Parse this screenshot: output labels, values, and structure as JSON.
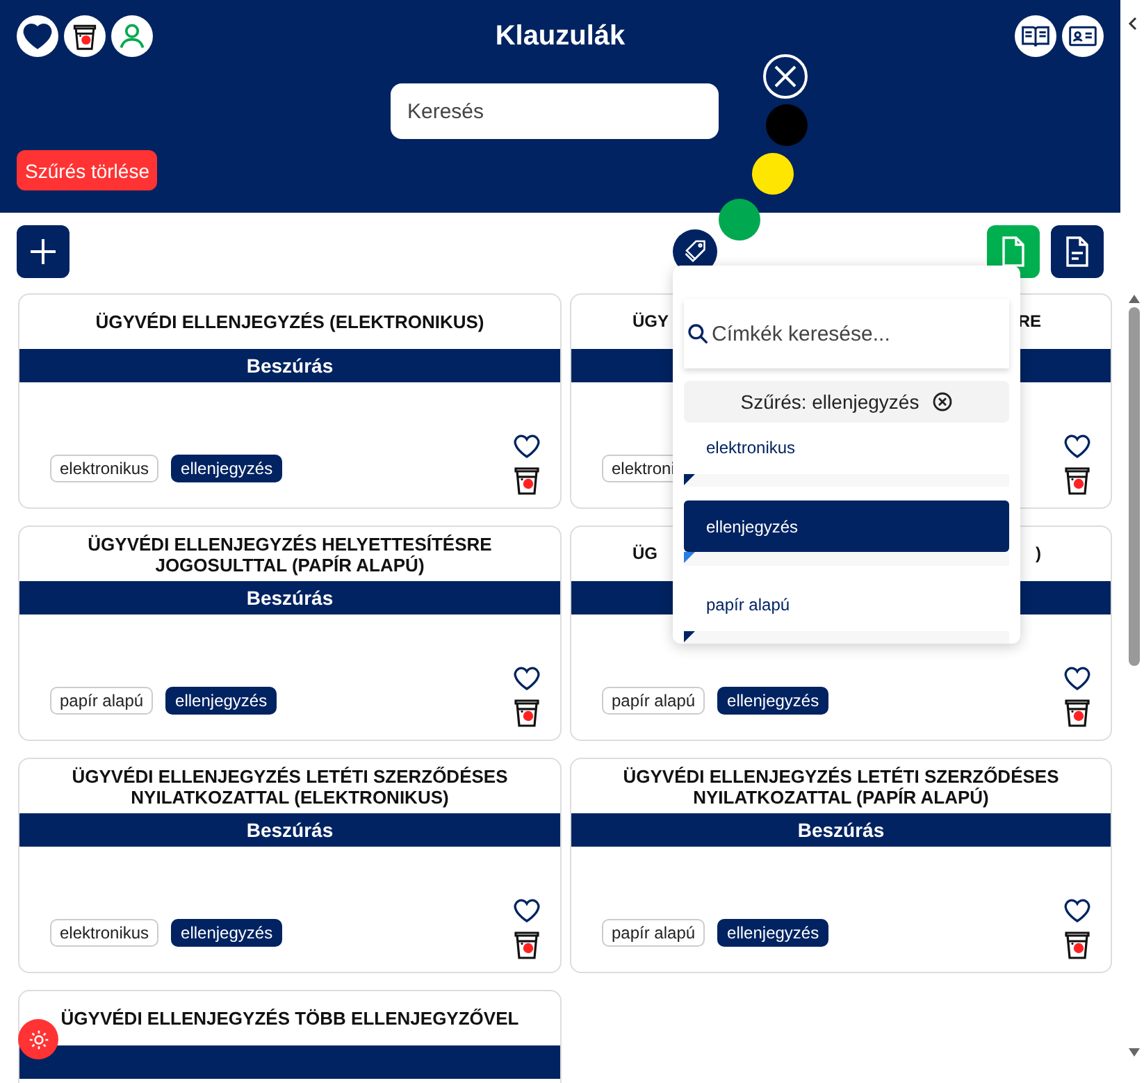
{
  "header": {
    "title": "Klauzulák",
    "search": {
      "placeholder": "Keresés"
    },
    "clear_filter": "Szűrés törlése"
  },
  "color_options": [
    {
      "color": "#000000"
    },
    {
      "color": "#ffe600"
    },
    {
      "color": "#00a94f"
    }
  ],
  "tag_popup": {
    "search": {
      "placeholder": "Címkék keresése..."
    },
    "active_filter": "Szűrés: ellenjegyzés",
    "tags": [
      {
        "label": "elektronikus",
        "selected": false
      },
      {
        "label": "ellenjegyzés",
        "selected": true
      },
      {
        "label": "papír alapú",
        "selected": false
      }
    ]
  },
  "cards": [
    {
      "title": "ÜGYVÉDI ELLENJEGYZÉS (ELEKTRONIKUS)",
      "insert": "Beszúrás",
      "tags": [
        {
          "label": "elektronikus",
          "kind": "outline"
        },
        {
          "label": "ellenjegyzés",
          "kind": "filled"
        }
      ]
    },
    {
      "title_parts": [
        "ÜGY",
        "RE"
      ],
      "tags": [
        {
          "label": "elektroni",
          "kind": "outline"
        }
      ]
    },
    {
      "title": "ÜGYVÉDI ELLENJEGYZÉS HELYETTESÍTÉSRE JOGOSULTTAL (PAPÍR ALAPÚ)",
      "insert": "Beszúrás",
      "tags": [
        {
          "label": "papír alapú",
          "kind": "outline"
        },
        {
          "label": "ellenjegyzés",
          "kind": "filled"
        }
      ]
    },
    {
      "title_parts": [
        "ÜG",
        ")"
      ],
      "tags": [
        {
          "label": "papír alapú",
          "kind": "outline"
        },
        {
          "label": "ellenjegyzés",
          "kind": "filled"
        }
      ]
    },
    {
      "title": "ÜGYVÉDI ELLENJEGYZÉS LETÉTI SZERZŐDÉSES NYILATKOZATTAL (ELEKTRONIKUS)",
      "insert": "Beszúrás",
      "tags": [
        {
          "label": "elektronikus",
          "kind": "outline"
        },
        {
          "label": "ellenjegyzés",
          "kind": "filled"
        }
      ]
    },
    {
      "title": "ÜGYVÉDI ELLENJEGYZÉS LETÉTI SZERZŐDÉSES NYILATKOZATTAL (PAPÍR ALAPÚ)",
      "insert": "Beszúrás",
      "tags": [
        {
          "label": "papír alapú",
          "kind": "outline"
        },
        {
          "label": "ellenjegyzés",
          "kind": "filled"
        }
      ]
    },
    {
      "title": "ÜGYVÉDI ELLENJEGYZÉS TÖBB ELLENJEGYZŐVEL"
    }
  ]
}
